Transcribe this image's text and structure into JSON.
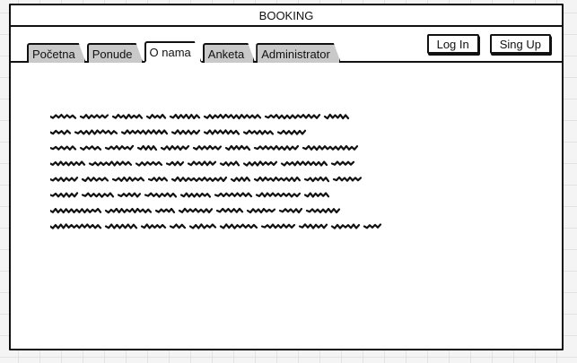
{
  "window": {
    "title": "BOOKING"
  },
  "nav": {
    "tabs": [
      {
        "label": "Početna",
        "active": false
      },
      {
        "label": "Ponude",
        "active": false
      },
      {
        "label": "O nama",
        "active": true
      },
      {
        "label": "Anketa",
        "active": false
      },
      {
        "label": "Administrator",
        "active": false
      }
    ]
  },
  "auth": {
    "login_label": "Log In",
    "signup_label": "Sing Up"
  },
  "colors": {
    "stroke": "#111111",
    "inactive_tab": "#c9c9c9",
    "active_tab": "#ffffff"
  }
}
